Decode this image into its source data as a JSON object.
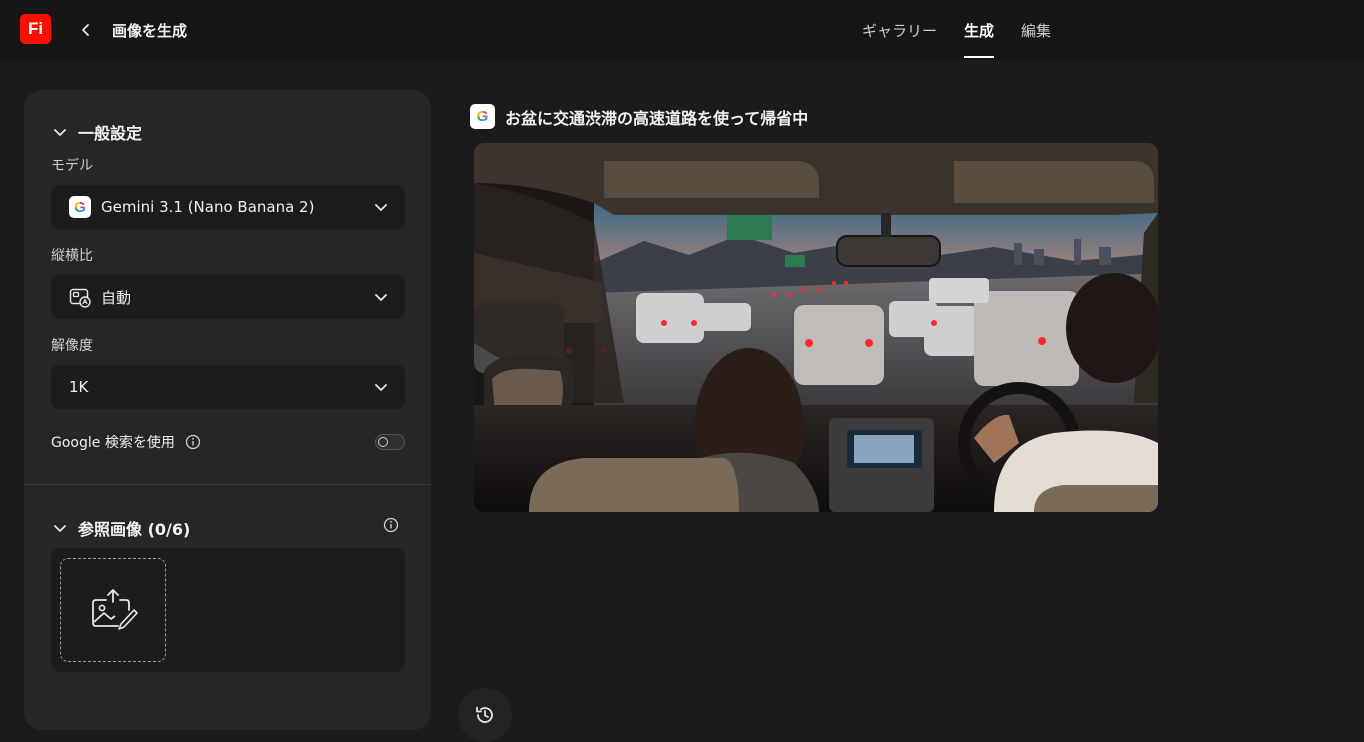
{
  "app": {
    "logo_text": "Fi",
    "logo_color": "#fa0f00"
  },
  "header": {
    "page_title": "画像を生成",
    "tabs": [
      {
        "label": "ギャラリー",
        "active": false
      },
      {
        "label": "生成",
        "active": true
      },
      {
        "label": "編集",
        "active": false
      }
    ]
  },
  "settings": {
    "general_title": "一般設定",
    "model": {
      "label": "モデル",
      "value": "Gemini 3.1 (Nano Banana 2)",
      "icon": "google-g-icon"
    },
    "aspect": {
      "label": "縦横比",
      "value": "自動",
      "icon": "aspect-auto-icon"
    },
    "resolution": {
      "label": "解像度",
      "value": "1K"
    },
    "google_search": {
      "label": "Google 検索を使用",
      "enabled": false
    },
    "reference": {
      "title": "参照画像 (0/6)"
    }
  },
  "result": {
    "model_icon": "google-g-icon",
    "prompt": "お盆に交通渋滞の高速道路を使って帰省中"
  },
  "icons": {
    "back": "chevron-left-icon",
    "collapse": "chevron-down-icon",
    "info": "info-icon",
    "upload": "image-upload-icon",
    "history": "history-icon"
  }
}
